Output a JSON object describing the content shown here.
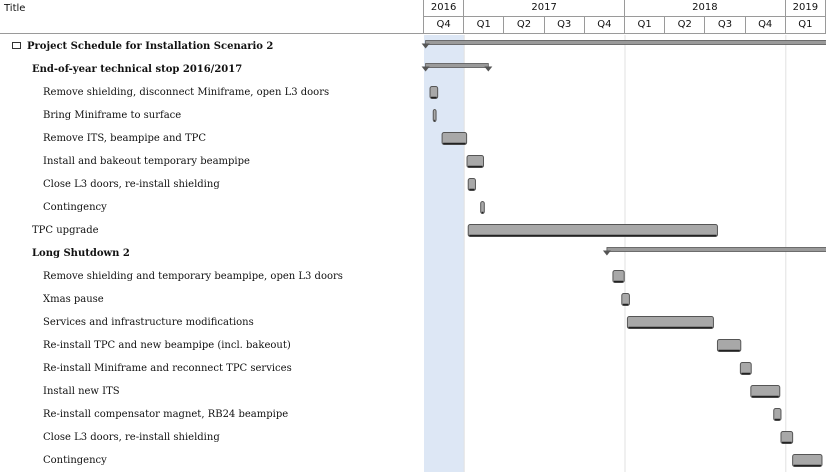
{
  "header": {
    "title": "Title",
    "years": [
      {
        "label": "2016",
        "span_quarters": 1
      },
      {
        "label": "2017",
        "span_quarters": 4
      },
      {
        "label": "2018",
        "span_quarters": 4
      },
      {
        "label": "2019",
        "span_quarters": 1
      }
    ],
    "quarters": [
      "Q4",
      "Q1",
      "Q2",
      "Q3",
      "Q4",
      "Q1",
      "Q2",
      "Q3",
      "Q4",
      "Q1"
    ]
  },
  "colors": {
    "bar_fill": "#a8a8a8",
    "bar_border": "#555555",
    "summary_fill": "#9a9a9a",
    "today_band": "#dde7f5",
    "grid": "#e2e2e2"
  },
  "chart_data": {
    "type": "gantt",
    "tasks": [
      {
        "name": "Project Schedule for Installation Scenario 2",
        "kind": "summary",
        "level": 0,
        "collapsible": true,
        "start_quarter": 0.04,
        "end_quarter": 10.15
      },
      {
        "name": "End-of-year technical stop 2016/2017",
        "kind": "summary",
        "level": 0,
        "start_quarter": 0.04,
        "end_quarter": 1.6
      },
      {
        "name": "Remove shielding, disconnect Miniframe, open L3 doors",
        "kind": "task",
        "level": 1,
        "start_quarter": 0.15,
        "end_quarter": 0.34
      },
      {
        "name": "Bring Miniframe to surface",
        "kind": "task",
        "level": 1,
        "start_quarter": 0.23,
        "end_quarter": 0.3
      },
      {
        "name": "Remove ITS, beampipe and TPC",
        "kind": "task",
        "level": 1,
        "start_quarter": 0.45,
        "end_quarter": 1.06
      },
      {
        "name": "Install and bakeout temporary beampipe",
        "kind": "task",
        "level": 1,
        "start_quarter": 1.07,
        "end_quarter": 1.48
      },
      {
        "name": "Close L3 doors, re-install shielding",
        "kind": "task",
        "level": 1,
        "start_quarter": 1.1,
        "end_quarter": 1.28
      },
      {
        "name": "Contingency",
        "kind": "task",
        "level": 1,
        "start_quarter": 1.41,
        "end_quarter": 1.5
      },
      {
        "name": "TPC upgrade",
        "kind": "task",
        "level": 0,
        "start_quarter": 1.1,
        "end_quarter": 7.3
      },
      {
        "name": "Long Shutdown 2",
        "kind": "summary",
        "level": 0,
        "start_quarter": 4.55,
        "end_quarter": 10.15
      },
      {
        "name": "Remove shielding and temporary beampipe, open L3 doors",
        "kind": "task",
        "level": 1,
        "start_quarter": 4.7,
        "end_quarter": 4.98
      },
      {
        "name": "Xmas pause",
        "kind": "task",
        "level": 1,
        "start_quarter": 4.92,
        "end_quarter": 5.11
      },
      {
        "name": "Services and infrastructure modifications",
        "kind": "task",
        "level": 1,
        "start_quarter": 5.06,
        "end_quarter": 7.2
      },
      {
        "name": "Re-install TPC and new beampipe (incl. bakeout)",
        "kind": "task",
        "level": 1,
        "start_quarter": 7.3,
        "end_quarter": 7.88
      },
      {
        "name": "Re-install Miniframe and reconnect TPC services",
        "kind": "task",
        "level": 1,
        "start_quarter": 7.87,
        "end_quarter": 8.14
      },
      {
        "name": "Install new ITS",
        "kind": "task",
        "level": 1,
        "start_quarter": 8.13,
        "end_quarter": 8.85
      },
      {
        "name": "Re-install compensator magnet, RB24 beampipe",
        "kind": "task",
        "level": 1,
        "start_quarter": 8.7,
        "end_quarter": 8.88
      },
      {
        "name": "Close L3 doors, re-install shielding",
        "kind": "task",
        "level": 1,
        "start_quarter": 8.88,
        "end_quarter": 9.17
      },
      {
        "name": "Contingency",
        "kind": "task",
        "level": 1,
        "start_quarter": 9.17,
        "end_quarter": 9.9
      }
    ]
  }
}
